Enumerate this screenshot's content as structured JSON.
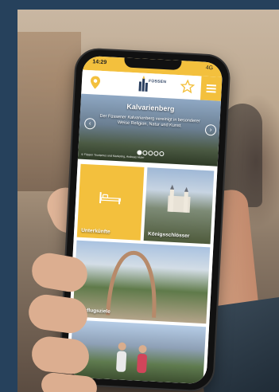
{
  "statusbar": {
    "time": "14:29",
    "signal": "4G"
  },
  "header": {
    "logo_text": "FÜSSEN"
  },
  "hero": {
    "title": "Kalvarienberg",
    "text": "Der Füssener Kalvarienberg vereinigt in besonderer Weise Religion, Natur und Kunst.",
    "credit": "© Füssen Tourismus und Marketing, Andreas Huter"
  },
  "tiles": [
    {
      "label": "Unterkünfte"
    },
    {
      "label": "Königsschlösser"
    },
    {
      "label": "Ausflugsziele"
    },
    {
      "label": ""
    }
  ],
  "colors": {
    "accent": "#f3c03d",
    "brand": "#2a3f60"
  }
}
